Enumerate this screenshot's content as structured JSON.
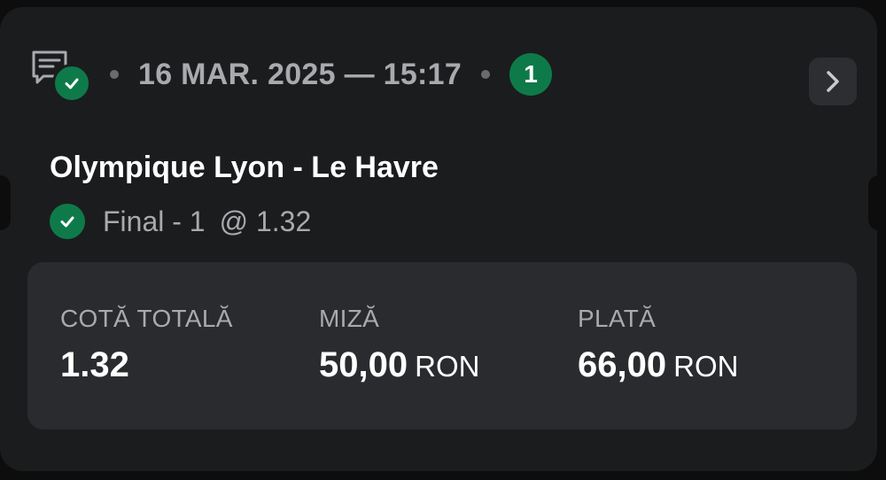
{
  "header": {
    "datetime": "16 MAR. 2025 — 15:17",
    "count": "1"
  },
  "match": {
    "title": "Olympique Lyon - Le Havre",
    "selection": "Final - 1",
    "odds": "@ 1.32"
  },
  "summary": {
    "total_odds_label": "COTĂ TOTALĂ",
    "total_odds_value": "1.32",
    "stake_label": "MIZĂ",
    "stake_value": "50,00",
    "stake_unit": "RON",
    "payout_label": "PLATĂ",
    "payout_value": "66,00",
    "payout_unit": "RON"
  },
  "icons": {
    "ticket": "ticket-icon",
    "status": "check-icon",
    "navigate": "chevron-right-icon"
  },
  "colors": {
    "accent_green": "#0e7a4a",
    "card_background": "#1b1c1e",
    "summary_background": "#292b2e",
    "muted_text": "#a9aaad"
  }
}
